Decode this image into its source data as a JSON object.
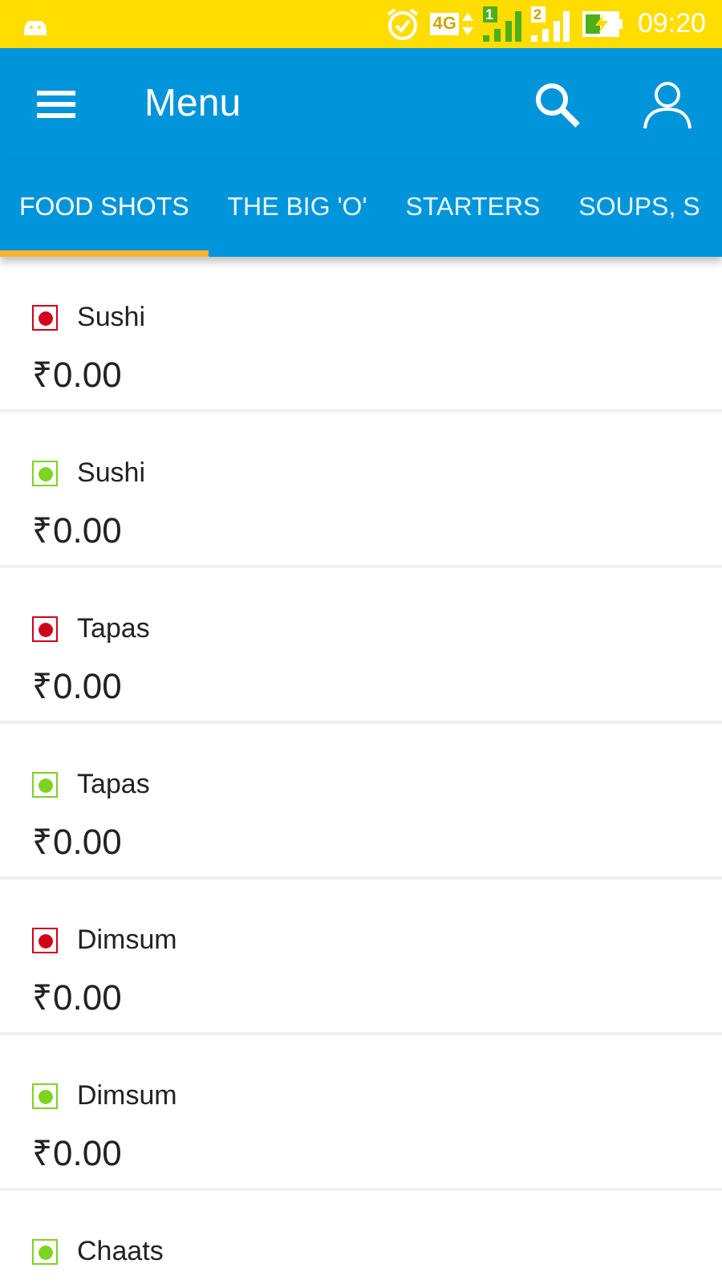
{
  "status_bar": {
    "network": "4G",
    "sim_1": "1",
    "sim_2": "2",
    "time": "09:20"
  },
  "app_bar": {
    "title": "Menu"
  },
  "tabs": [
    {
      "label": "FOOD SHOTS",
      "selected": true
    },
    {
      "label": "THE BIG 'O'",
      "selected": false
    },
    {
      "label": "STARTERS",
      "selected": false
    },
    {
      "label": "SOUPS, S",
      "selected": false
    }
  ],
  "items": [
    {
      "name": "Sushi",
      "price": "₹0.00",
      "color": "#d0021b"
    },
    {
      "name": "Sushi",
      "price": "₹0.00",
      "color": "#7ed321"
    },
    {
      "name": "Tapas",
      "price": "₹0.00",
      "color": "#d0021b"
    },
    {
      "name": "Tapas",
      "price": "₹0.00",
      "color": "#7ed321"
    },
    {
      "name": "Dimsum",
      "price": "₹0.00",
      "color": "#d0021b"
    },
    {
      "name": "Dimsum",
      "price": "₹0.00",
      "color": "#7ed321"
    },
    {
      "name": "Chaats",
      "color": "#7ed321"
    }
  ]
}
